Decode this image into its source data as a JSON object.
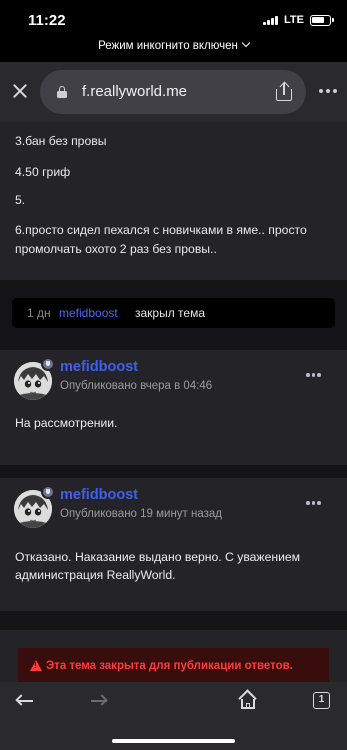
{
  "status_bar": {
    "time": "11:22",
    "network": "LTE",
    "icons": [
      "signal-icon",
      "battery-icon"
    ]
  },
  "incognito": {
    "label": "Режим инкогнито включен"
  },
  "browser": {
    "url": "f.reallyworld.me",
    "icons": [
      "close-icon",
      "lock-icon",
      "share-icon",
      "more-icon"
    ]
  },
  "first_post": {
    "lines": [
      "3.бан без провы",
      "4.50 гриф",
      "5.",
      "6.просто сидел пехался с новичками в яме.. просто",
      "промолчать охото 2 раз без провы.."
    ]
  },
  "event": {
    "time": "1 дн",
    "user": "mefidboost",
    "action": "закрыл тема"
  },
  "posts": [
    {
      "author": "mefidboost",
      "meta": "Опубликовано вчера в 04:46",
      "lines": [
        "На рассмотрении."
      ]
    },
    {
      "author": "mefidboost",
      "meta": "Опубликовано 19 минут назад",
      "lines": [
        "Отказано. Наказание выдано верно. С уважением",
        "администрация ReallyWorld."
      ]
    }
  ],
  "locked": {
    "text": "Эта тема закрыта для публикации ответов."
  },
  "bottom_nav": {
    "tab_count": "1",
    "icons": [
      "back-arrow-icon",
      "forward-arrow-icon",
      "home-icon",
      "tabs-icon"
    ]
  },
  "colors": {
    "accent": "#3f5ff2",
    "link": "#4a6cf7",
    "danger": "#ff3b3b",
    "card": "#242428",
    "background": "#141416"
  }
}
